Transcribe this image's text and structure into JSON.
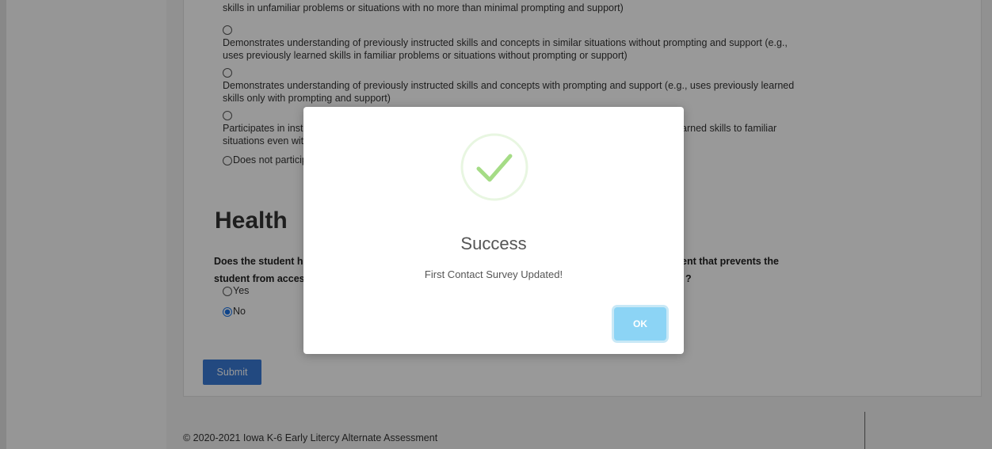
{
  "options": [
    {
      "text": "skills in unfamiliar problems or situations with no more than minimal prompting and support)"
    },
    {
      "text": "Demonstrates understanding of previously instructed skills and concepts in similar situations without prompting and support (e.g., uses previously learned skills in familiar problems or situations without prompting or support)"
    },
    {
      "text": "Demonstrates understanding of previously instructed skills and concepts with prompting and support (e.g., uses previously learned skills only with prompting and support)"
    },
    {
      "text": "Participates in instru",
      "tail": "arned skills to familiar",
      "line2": "situations even with"
    },
    {
      "text": "Does not participa"
    }
  ],
  "health": {
    "title": "Health",
    "question_line1_left": "Does the student h",
    "question_line1_right": "ent that prevents the",
    "question_line2_left": "student from acces",
    "question_line2_right": "?",
    "yes_label": "Yes",
    "no_label": "No",
    "selected": "No"
  },
  "submit_label": "Submit",
  "footer": "© 2020-2021 Iowa K-6 Early Litercy Alternate Assessment",
  "modal": {
    "title": "Success",
    "message": "First Contact Survey Updated!",
    "ok_label": "OK",
    "icon": "success-check-icon",
    "icon_color": "#a5dc86"
  },
  "colors": {
    "submit": "#3a7bd5",
    "ok_button": "#8cd4f5",
    "radio_checked": "#1a73e8"
  }
}
